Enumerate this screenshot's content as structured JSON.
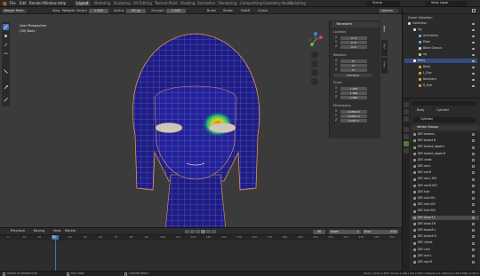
{
  "topbar": {
    "menus": [
      "File",
      "Edit",
      "Render",
      "Window",
      "Help"
    ],
    "workspaces": [
      "Layout",
      "Modeling",
      "Sculpting",
      "UV Editing",
      "Texture Paint",
      "Shading",
      "Animation",
      "Rendering",
      "Compositing",
      "Geometry Nodes",
      "Scripting"
    ],
    "active_workspace": "Layout",
    "scene": "Scene",
    "view_layer": "View Layer"
  },
  "header": {
    "mode": "Weight Paint",
    "view_menus": [
      "View",
      "Weights"
    ],
    "weight_label": "Weight",
    "weight_value": "1.000",
    "radius_label": "Radius",
    "radius_value": "50 px",
    "strength_label": "Strength",
    "strength_value": "1.000",
    "menus_right": [
      "Brush",
      "Stroke",
      "Falloff",
      "Cursor"
    ],
    "options": "Options"
  },
  "viewport": {
    "overlay_line1": "User Perspective",
    "overlay_line2": "(30) Body"
  },
  "npanel": {
    "title": "Transform",
    "location_label": "Location:",
    "location": [
      {
        "axis": "X",
        "value": "0 m"
      },
      {
        "axis": "Y",
        "value": "0 m"
      },
      {
        "axis": "Z",
        "value": "0 m"
      }
    ],
    "rotation_label": "Rotation:",
    "rotation": [
      {
        "axis": "X",
        "value": "0°"
      },
      {
        "axis": "Y",
        "value": "0°"
      },
      {
        "axis": "Z",
        "value": "0°"
      }
    ],
    "rotation_mode": "XYZ Euler",
    "scale_label": "Scale:",
    "scale": [
      {
        "axis": "X",
        "value": "1.000"
      },
      {
        "axis": "Y",
        "value": "1.000"
      },
      {
        "axis": "Z",
        "value": "1.000"
      }
    ],
    "dimensions_label": "Dimensions:",
    "dimensions": [
      {
        "axis": "X",
        "value": "0.2593 m"
      },
      {
        "axis": "Y",
        "value": "0.0635 m"
      },
      {
        "axis": "Z",
        "value": "0.342 m"
      }
    ],
    "tabs": [
      "Item",
      "Tool",
      "View"
    ]
  },
  "timeline": {
    "menus": [
      "Playback",
      "Keying",
      "View",
      "Marker"
    ],
    "current_frame": "30",
    "start_label": "Start",
    "start": "1",
    "end_label": "End",
    "end": "250",
    "ticks": [
      "0",
      "10",
      "20",
      "30",
      "40",
      "50",
      "60",
      "70",
      "80",
      "90",
      "100",
      "110",
      "120",
      "130",
      "140",
      "150",
      "160",
      "170",
      "180",
      "190",
      "200",
      "210",
      "220",
      "230",
      "240",
      "250"
    ]
  },
  "statusbar": {
    "left": "Select or Deselect All",
    "middle1": "Pan View",
    "middle2": "Context Menu",
    "right": "Body | Verts 1,456 | Faces 1,436 | Tris 2,850 | Objects 1/1 | Memory: 56.9 MiB | 2.93.4"
  },
  "outliner": {
    "title": "Scene Collection",
    "items": [
      {
        "label": "Collection",
        "indent": 0,
        "color": "#d8d8d8"
      },
      {
        "label": "rig",
        "indent": 1,
        "color": "#d8d8d8"
      },
      {
        "label": "Animation",
        "indent": 2,
        "color": "#6fb3e6"
      },
      {
        "label": "Pose",
        "indent": 2,
        "color": "#6fb3e6"
      },
      {
        "label": "Bone Groups",
        "indent": 2,
        "color": "#cfcfcf"
      },
      {
        "label": "rig",
        "indent": 2,
        "color": "#9fdc7f"
      },
      {
        "label": "Body",
        "indent": 1,
        "color": "#ffffff"
      },
      {
        "label": "Body",
        "indent": 2,
        "color": "#e89a4a"
      },
      {
        "label": "L_Eye",
        "indent": 2,
        "color": "#e89a4a"
      },
      {
        "label": "Necklace",
        "indent": 2,
        "color": "#e89a4a"
      },
      {
        "label": "R_Eye",
        "indent": 2,
        "color": "#e89a4a"
      }
    ],
    "selected_index": 6
  },
  "properties": {
    "object_name": "Body",
    "data_name": "Cylinder",
    "mesh_name": "Cylinder",
    "section": "Vertex Groups",
    "groups": [
      "DEF-breast.L",
      "DEF-breast.R",
      "DEF-breast_nipple.L",
      "DEF-breast_nipple.R",
      "DEF-chest",
      "DEF-ear.L",
      "DEF-ear.R",
      "DEF-ear.L.001",
      "DEF-ear.R.001",
      "DEF-hair",
      "DEF-hair.001",
      "DEF-hair.002",
      "DEF-hair.003",
      "DEF-brow.T.L",
      "DEF-brow.T.R",
      "DEF-brow.B.L",
      "DEF-brow.B.R",
      "DEF-cheek",
      "DEF-chin",
      "DEF-eye.L",
      "DEF-eye.R"
    ],
    "selected_index": 13
  },
  "colors": {
    "accent": "#4772b3",
    "mesh": "#1d1d86",
    "wire": "#e0955a",
    "selection": "#ff9a2a"
  }
}
